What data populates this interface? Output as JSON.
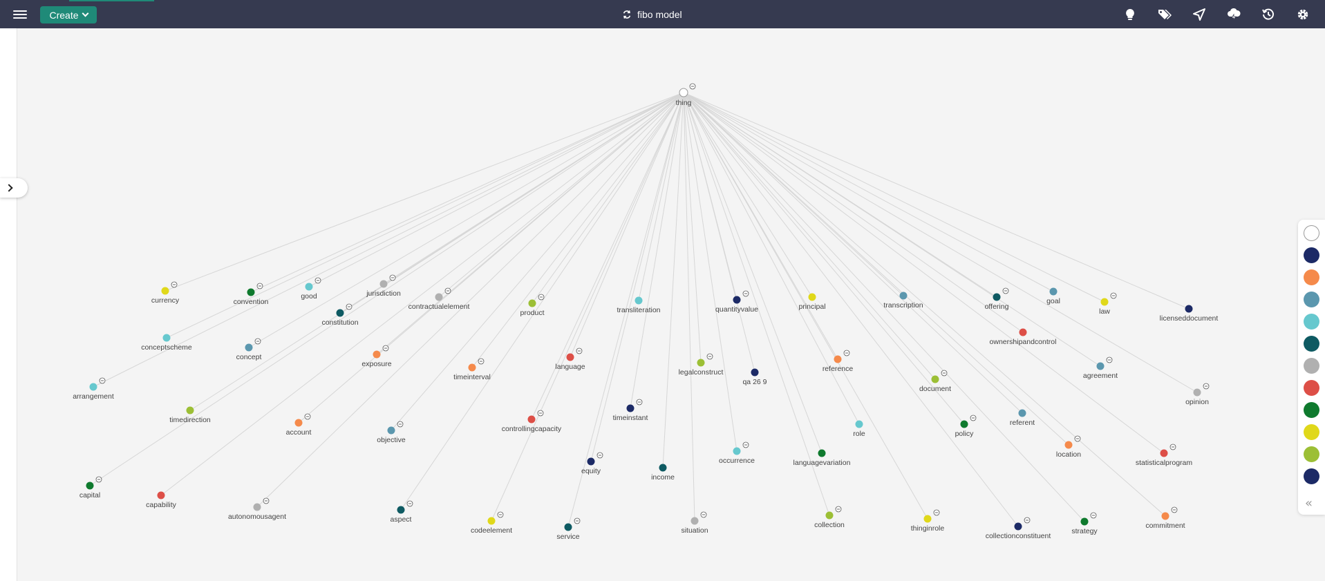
{
  "header": {
    "create_label": "Create",
    "title": "fibo model",
    "icons": [
      "lightbulb-icon",
      "tags-icon",
      "send-icon",
      "cloud-lightning-icon",
      "history-icon",
      "gear-icon"
    ]
  },
  "colors": {
    "topbar": "#363a50",
    "accent": "#1f8a78",
    "edge": "#d6d6d6"
  },
  "graph": {
    "root": {
      "label": "thing"
    },
    "nodes": [
      {
        "label": "currency",
        "color": "#e0d81a",
        "collapse": true
      },
      {
        "label": "convention",
        "color": "#0f7a2e",
        "collapse": true
      },
      {
        "label": "good",
        "color": "#66c8ce",
        "collapse": true
      },
      {
        "label": "jurisdiction",
        "color": "#b0b0b0",
        "collapse": true
      },
      {
        "label": "constitution",
        "color": "#0e5a62",
        "collapse": true
      },
      {
        "label": "contractualelement",
        "color": "#b0b0b0",
        "collapse": true
      },
      {
        "label": "product",
        "color": "#9cbf35",
        "collapse": true
      },
      {
        "label": "transliteration",
        "color": "#66c8ce",
        "collapse": false
      },
      {
        "label": "quantityvalue",
        "color": "#1c2a66",
        "collapse": true
      },
      {
        "label": "principal",
        "color": "#e0d81a",
        "collapse": false
      },
      {
        "label": "transcription",
        "color": "#5b97ae",
        "collapse": false
      },
      {
        "label": "offering",
        "color": "#0e5a62",
        "collapse": true
      },
      {
        "label": "goal",
        "color": "#5b97ae",
        "collapse": false
      },
      {
        "label": "law",
        "color": "#e0d81a",
        "collapse": true
      },
      {
        "label": "licenseddocument",
        "color": "#1c2a66",
        "collapse": false
      },
      {
        "label": "conceptscheme",
        "color": "#66c8ce",
        "collapse": false
      },
      {
        "label": "concept",
        "color": "#5b97ae",
        "collapse": true
      },
      {
        "label": "exposure",
        "color": "#f58a4b",
        "collapse": true
      },
      {
        "label": "timeinterval",
        "color": "#f58a4b",
        "collapse": true
      },
      {
        "label": "language",
        "color": "#dd4f47",
        "collapse": true
      },
      {
        "label": "legalconstruct",
        "color": "#9cbf35",
        "collapse": true
      },
      {
        "label": "qa 26 9",
        "color": "#1c2a66",
        "collapse": false
      },
      {
        "label": "reference",
        "color": "#f58a4b",
        "collapse": true
      },
      {
        "label": "ownershipandcontrol",
        "color": "#dd4f47",
        "collapse": false
      },
      {
        "label": "document",
        "color": "#9cbf35",
        "collapse": true
      },
      {
        "label": "agreement",
        "color": "#5b97ae",
        "collapse": true
      },
      {
        "label": "opinion",
        "color": "#b0b0b0",
        "collapse": true
      },
      {
        "label": "arrangement",
        "color": "#66c8ce",
        "collapse": true
      },
      {
        "label": "timedirection",
        "color": "#9cbf35",
        "collapse": false
      },
      {
        "label": "account",
        "color": "#f58a4b",
        "collapse": true
      },
      {
        "label": "objective",
        "color": "#5b97ae",
        "collapse": true
      },
      {
        "label": "controllingcapacity",
        "color": "#dd4f47",
        "collapse": true
      },
      {
        "label": "timeinstant",
        "color": "#1c2a66",
        "collapse": true
      },
      {
        "label": "role",
        "color": "#66c8ce",
        "collapse": false
      },
      {
        "label": "policy",
        "color": "#0f7a2e",
        "collapse": true
      },
      {
        "label": "referent",
        "color": "#5b97ae",
        "collapse": false
      },
      {
        "label": "location",
        "color": "#f58a4b",
        "collapse": true
      },
      {
        "label": "statisticalprogram",
        "color": "#dd4f47",
        "collapse": true
      },
      {
        "label": "occurrence",
        "color": "#66c8ce",
        "collapse": true
      },
      {
        "label": "languagevariation",
        "color": "#0f7a2e",
        "collapse": false
      },
      {
        "label": "equity",
        "color": "#1c2a66",
        "collapse": true
      },
      {
        "label": "income",
        "color": "#0e5a62",
        "collapse": false
      },
      {
        "label": "capital",
        "color": "#0f7a2e",
        "collapse": true
      },
      {
        "label": "capability",
        "color": "#dd4f47",
        "collapse": false
      },
      {
        "label": "autonomousagent",
        "color": "#b0b0b0",
        "collapse": true
      },
      {
        "label": "aspect",
        "color": "#0e5a62",
        "collapse": true
      },
      {
        "label": "codeelement",
        "color": "#e0d81a",
        "collapse": true
      },
      {
        "label": "service",
        "color": "#0e5a62",
        "collapse": true
      },
      {
        "label": "situation",
        "color": "#b0b0b0",
        "collapse": true
      },
      {
        "label": "collection",
        "color": "#9cbf35",
        "collapse": true
      },
      {
        "label": "thinginrole",
        "color": "#e0d81a",
        "collapse": true
      },
      {
        "label": "collectionconstituent",
        "color": "#1c2a66",
        "collapse": true
      },
      {
        "label": "strategy",
        "color": "#0f7a2e",
        "collapse": true
      },
      {
        "label": "commitment",
        "color": "#f58a4b",
        "collapse": true
      }
    ]
  },
  "palette": {
    "swatches": [
      "#ffffff",
      "#1c2a66",
      "#f58a4b",
      "#5b97ae",
      "#66c8ce",
      "#0e5a62",
      "#b0b0b0",
      "#dd4f47",
      "#0f7a2e",
      "#e0d81a",
      "#9cbf35",
      "#1c2a66"
    ]
  }
}
